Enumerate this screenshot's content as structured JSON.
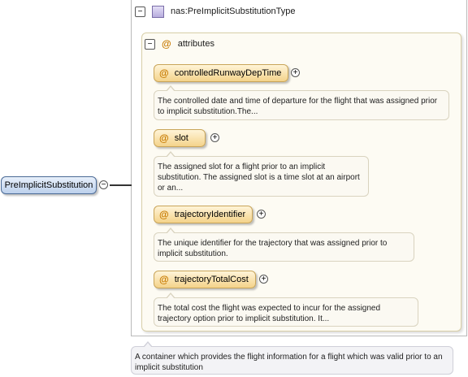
{
  "root": {
    "name": "PreImplicitSubstitution",
    "toggle": "−",
    "description": "A container which provides the flight information for a flight which was valid prior to an implicit substitution"
  },
  "type": {
    "name": "nas:PreImplicitSubstitutionType",
    "toggle": "−"
  },
  "attributes_group": {
    "label": "attributes",
    "symbol": "@",
    "toggle": "−"
  },
  "attributes": [
    {
      "symbol": "@",
      "name": "controlledRunwayDepTime",
      "expand": "+",
      "description": "The controlled date and time of departure for the flight that was assigned prior to implicit substitution.The..."
    },
    {
      "symbol": "@",
      "name": "slot",
      "expand": "+",
      "description": "The assigned slot for a flight prior to an implicit substitution. The assigned slot is a time slot at an airport or an..."
    },
    {
      "symbol": "@",
      "name": "trajectoryIdentifier",
      "expand": "+",
      "description": "The unique identifier for the trajectory that was assigned prior to implicit substitution."
    },
    {
      "symbol": "@",
      "name": "trajectoryTotalCost",
      "expand": "+",
      "description": "The total cost the flight was expected to incur for the assigned trajectory option prior to implicit substitution. It..."
    }
  ],
  "colors": {
    "root_fill": "#bcd0ec",
    "attribute_fill": "#f4d38a",
    "type_icon": "#b7acdd"
  }
}
